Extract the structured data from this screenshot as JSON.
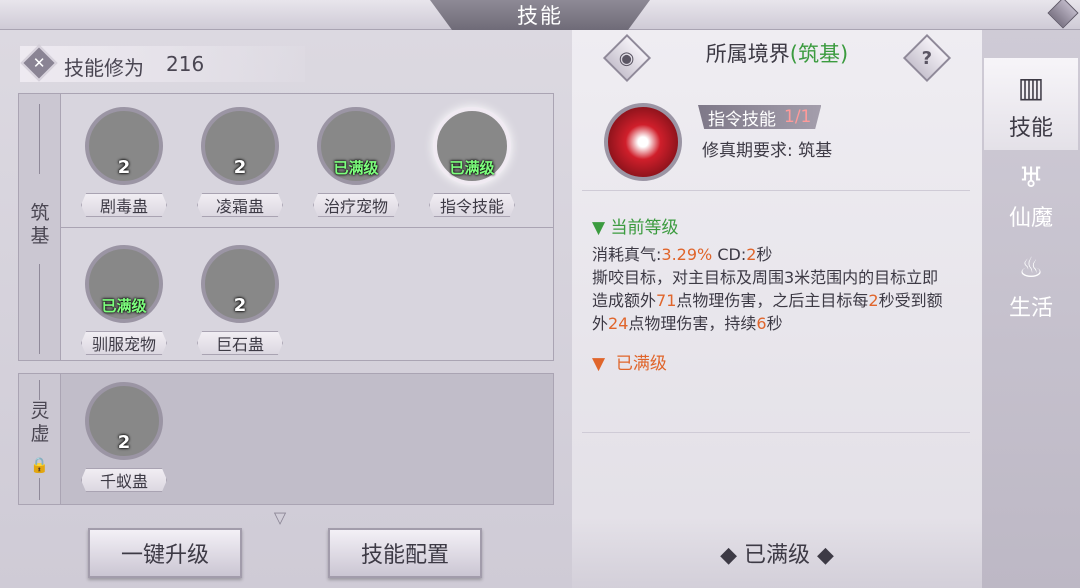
{
  "window": {
    "title": "技能"
  },
  "left": {
    "points_label": "技能修为",
    "points_value": "216",
    "sections": [
      {
        "label": "筑基"
      },
      {
        "label": "灵虚"
      }
    ],
    "skills_row1": [
      {
        "name": "剧毒蛊",
        "level": "2"
      },
      {
        "name": "凌霜蛊",
        "level": "2"
      },
      {
        "name": "治疗宠物",
        "status": "已满级"
      },
      {
        "name": "指令技能",
        "status": "已满级"
      }
    ],
    "skills_row2": [
      {
        "name": "驯服宠物",
        "status": "已满级"
      },
      {
        "name": "巨石蛊",
        "level": "2"
      }
    ],
    "skills_row3": [
      {
        "name": "千蚁蛊",
        "level": "2"
      }
    ],
    "buttons": {
      "upgrade_all": "一键升级",
      "config": "技能配置"
    }
  },
  "detail": {
    "realm_prefix": "所属境界",
    "realm_open": "(",
    "realm_name": "筑基",
    "realm_close": ")",
    "help": "?",
    "skill_type": "指令技能",
    "skill_count": "1/1",
    "requirement": "修真期要求: 筑基",
    "current_level_label": "当前等级",
    "cost_label": "消耗真气:",
    "cost_value": "3.29%",
    "cd_label": "CD:",
    "cd_value": "2",
    "cd_unit": "秒",
    "desc_1": "撕咬目标，对主目标及周围3米范围内的目标立即造成额外",
    "dmg1": "71",
    "desc_2": "点物理伤害，之后主目标每",
    "tick": "2",
    "desc_3": "秒受到额外",
    "dmg2": "24",
    "desc_4": "点物理伤害，持续",
    "dur": "6",
    "desc_5": "秒",
    "max_level_label": "已满级",
    "bottom_status": "◆ 已满级 ◆"
  },
  "tabs": [
    {
      "label": "技能",
      "icon": "book-icon",
      "active": true
    },
    {
      "label": "仙魔",
      "icon": "wings-icon",
      "active": false
    },
    {
      "label": "生活",
      "icon": "bowl-icon",
      "active": false
    }
  ],
  "colors": {
    "green": "#3b9b3f",
    "orange": "#e0652b",
    "maxed_green": "#7dff7d"
  }
}
